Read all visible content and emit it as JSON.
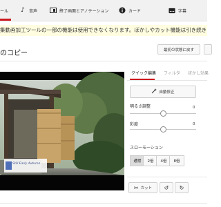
{
  "nav": {
    "items": [
      {
        "label": "ール",
        "icon": "scissors-icon"
      },
      {
        "label": "音声",
        "icon": "music-note-icon"
      },
      {
        "label": "終了画面とアノテーション",
        "icon": "end-screen-icon"
      },
      {
        "label": "カード",
        "icon": "info-icon"
      },
      {
        "label": "字幕",
        "icon": "captions-icon"
      }
    ]
  },
  "notice": {
    "text": "集動画加工ツールの一部の機能は使用できなくなります。ぼかしやカット機能は引き続きご利用いただけ"
  },
  "page": {
    "title": "のコピー"
  },
  "buttons": {
    "revert": "最初の状態に戻す"
  },
  "video": {
    "watermark": "Still Early Autumn"
  },
  "panel": {
    "tabs": [
      {
        "label": "クイック編集",
        "active": true
      },
      {
        "label": "フィルタ",
        "active": false
      },
      {
        "label": "ぼかし効果",
        "active": false
      }
    ],
    "auto_fix": "自動修正",
    "sliders": [
      {
        "label": "明るさ調整",
        "value": "0",
        "level": 0.5
      },
      {
        "label": "彩度",
        "value": "0",
        "level": 0.5
      }
    ],
    "slow_motion": {
      "label": "スローモーション",
      "options": [
        "通常",
        "2倍",
        "4倍",
        "8倍"
      ],
      "selected": "通常"
    },
    "tools": {
      "cut": "カット",
      "rotate_left_icon": "rotate-left-icon",
      "rotate_right_icon": "rotate-right-icon"
    }
  },
  "colors": {
    "accent": "#cc181e",
    "notice_bg": "#fffde0"
  }
}
